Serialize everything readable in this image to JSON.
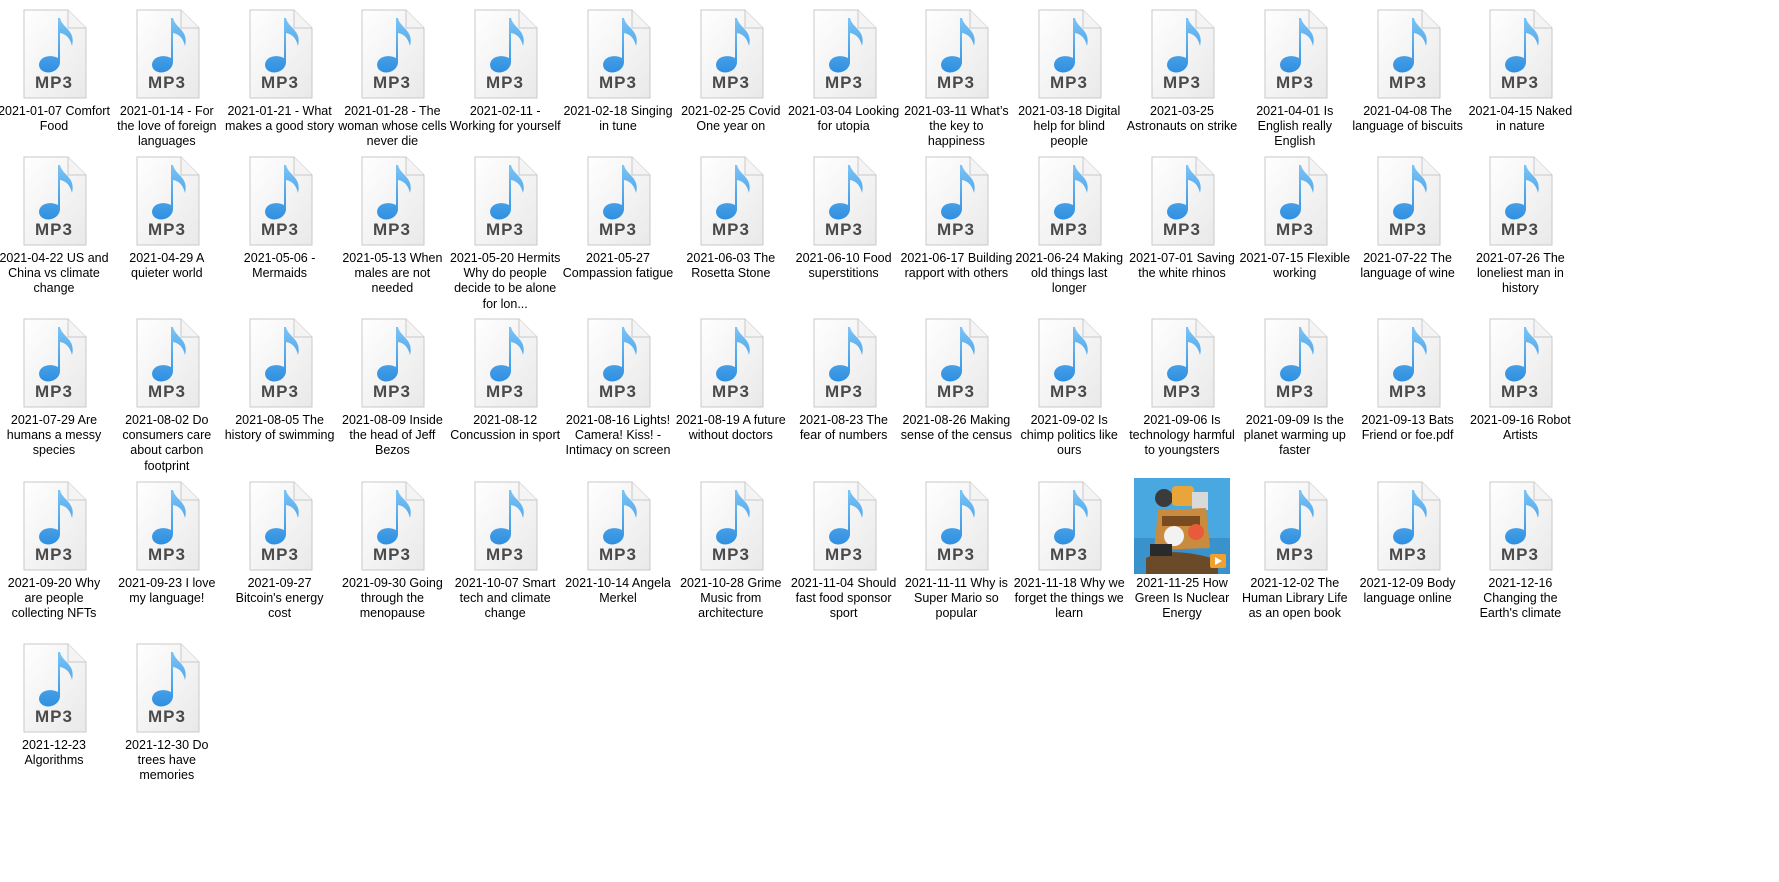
{
  "window": {
    "view": "Large icons"
  },
  "colors": {
    "note_blue": "#2f8fe0",
    "note_blue_light": "#7cc4f6",
    "mp3_text": "#4a4a4a",
    "label_text": "#000000"
  },
  "icons": {
    "audio_file": "mp3-file-icon",
    "image_file": "image-thumbnail-icon",
    "audio_badge": "MP3"
  },
  "files": [
    {
      "label": "2021-01-07 Comfort Food",
      "type": "mp3"
    },
    {
      "label": "2021-01-14 - For the love of foreign languages",
      "type": "mp3"
    },
    {
      "label": "2021-01-21 - What makes a good story",
      "type": "mp3"
    },
    {
      "label": "2021-01-28 - The woman whose cells never die",
      "type": "mp3"
    },
    {
      "label": "2021-02-11 - Working for yourself",
      "type": "mp3"
    },
    {
      "label": "2021-02-18 Singing in tune",
      "type": "mp3"
    },
    {
      "label": "2021-02-25  Covid One year on",
      "type": "mp3"
    },
    {
      "label": "2021-03-04 Looking for utopia",
      "type": "mp3"
    },
    {
      "label": "2021-03-11  What’s the key to happiness",
      "type": "mp3"
    },
    {
      "label": "2021-03-18 Digital help for blind people",
      "type": "mp3"
    },
    {
      "label": "2021-03-25 Astronauts on strike",
      "type": "mp3"
    },
    {
      "label": "2021-04-01  Is English really English",
      "type": "mp3"
    },
    {
      "label": "2021-04-08  The language of biscuits",
      "type": "mp3"
    },
    {
      "label": "2021-04-15 Naked in nature",
      "type": "mp3"
    },
    {
      "label": "2021-04-22  US and China vs climate change",
      "type": "mp3"
    },
    {
      "label": "2021-04-29  A quieter world",
      "type": "mp3"
    },
    {
      "label": "2021-05-06  - Mermaids",
      "type": "mp3"
    },
    {
      "label": "2021-05-13  When males are not needed",
      "type": "mp3"
    },
    {
      "label": "2021-05-20 Hermits Why do people decide to be alone for lon...",
      "type": "mp3"
    },
    {
      "label": "2021-05-27 Compassion fatigue",
      "type": "mp3"
    },
    {
      "label": "2021-06-03  The Rosetta Stone",
      "type": "mp3"
    },
    {
      "label": "2021-06-10  Food superstitions",
      "type": "mp3"
    },
    {
      "label": "2021-06-17 Building rapport with others",
      "type": "mp3"
    },
    {
      "label": "2021-06-24 Making old things last longer",
      "type": "mp3"
    },
    {
      "label": "2021-07-01 Saving the white rhinos",
      "type": "mp3"
    },
    {
      "label": "2021-07-15 Flexible working",
      "type": "mp3"
    },
    {
      "label": "2021-07-22  The language of wine",
      "type": "mp3"
    },
    {
      "label": "2021-07-26  The loneliest man in history",
      "type": "mp3"
    },
    {
      "label": "2021-07-29  Are humans a messy species",
      "type": "mp3"
    },
    {
      "label": "2021-08-02  Do consumers care about carbon footprint",
      "type": "mp3"
    },
    {
      "label": "2021-08-05  The history of swimming",
      "type": "mp3"
    },
    {
      "label": "2021-08-09 Inside the head of Jeff Bezos",
      "type": "mp3"
    },
    {
      "label": "2021-08-12 Concussion in sport",
      "type": "mp3"
    },
    {
      "label": "2021-08-16 Lights! Camera! Kiss! - Intimacy on screen",
      "type": "mp3"
    },
    {
      "label": "2021-08-19  A future without doctors",
      "type": "mp3"
    },
    {
      "label": "2021-08-23  The fear of numbers",
      "type": "mp3"
    },
    {
      "label": "2021-08-26 Making sense of the census",
      "type": "mp3"
    },
    {
      "label": "2021-09-02  Is chimp politics like ours",
      "type": "mp3"
    },
    {
      "label": "2021-09-06  Is technology harmful to youngsters",
      "type": "mp3"
    },
    {
      "label": "2021-09-09  Is the planet warming up faster",
      "type": "mp3"
    },
    {
      "label": "2021-09-13  Bats Friend or foe.pdf",
      "type": "mp3"
    },
    {
      "label": "2021-09-16 Robot Artists",
      "type": "mp3"
    },
    {
      "label": "2021-09-20  Why are people collecting NFTs",
      "type": "mp3"
    },
    {
      "label": "2021-09-23  I love my language!",
      "type": "mp3"
    },
    {
      "label": "2021-09-27 Bitcoin's energy cost",
      "type": "mp3"
    },
    {
      "label": "2021-09-30 Going through the menopause",
      "type": "mp3"
    },
    {
      "label": "2021-10-07 Smart tech and climate change",
      "type": "mp3"
    },
    {
      "label": "2021-10-14 Angela Merkel",
      "type": "mp3"
    },
    {
      "label": "2021-10-28 Grime Music from architecture",
      "type": "mp3"
    },
    {
      "label": "2021-11-04 Should fast food sponsor sport",
      "type": "mp3"
    },
    {
      "label": "2021-11-11  Why is Super Mario so popular",
      "type": "mp3"
    },
    {
      "label": "2021-11-18  Why we forget the things we learn",
      "type": "mp3"
    },
    {
      "label": "2021-11-25 How Green Is Nuclear Energy",
      "type": "thumb"
    },
    {
      "label": "2021-12-02  The Human Library Life as an open book",
      "type": "mp3"
    },
    {
      "label": "2021-12-09  Body language online",
      "type": "mp3"
    },
    {
      "label": "2021-12-16 Changing the Earth's climate",
      "type": "mp3"
    },
    {
      "label": "2021-12-23 Algorithms",
      "type": "mp3"
    },
    {
      "label": "2021-12-30  Do trees have memories",
      "type": "mp3"
    }
  ]
}
